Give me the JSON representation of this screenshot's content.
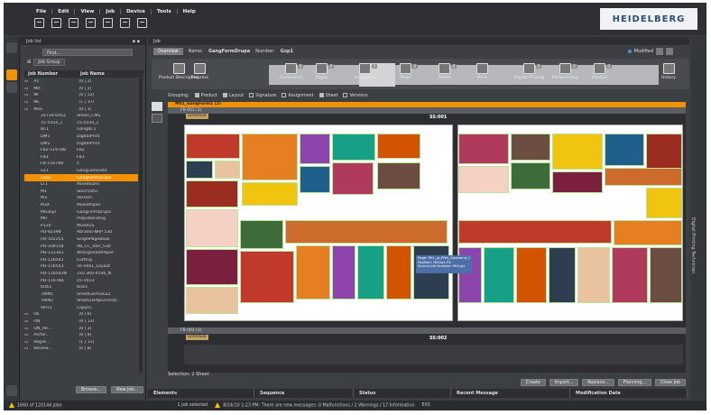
{
  "menu": [
    "File",
    "Edit",
    "View",
    "Job",
    "Device",
    "Tools",
    "Help"
  ],
  "logo": "HEIDELBERG",
  "jobs_panel": {
    "title": "Job list",
    "filter_placeholder": "Find...",
    "group_label": "Job Group",
    "col_job_number": "Job Number",
    "col_job_name": "Job Name",
    "browse_label": "Browse...",
    "new_job_label": "New Job..."
  },
  "jobs": [
    {
      "num": "A1",
      "name": "(0 | 2)",
      "folder": true
    },
    {
      "num": "MH",
      "name": "(0 | 1)",
      "folder": true
    },
    {
      "num": "MI",
      "name": "(0 | 12)",
      "folder": true
    },
    {
      "num": "ML",
      "name": "(1 | 37)",
      "folder": true
    },
    {
      "num": "MoS",
      "name": "(0 | 3)",
      "folder": true
    },
    {
      "num": "24716-0412",
      "name": "Shoes_CMS"
    },
    {
      "num": "15-5554_1",
      "name": "15-5554_1"
    },
    {
      "num": "BC1",
      "name": "GangBC1"
    },
    {
      "num": "DM1",
      "name": "DigitalPrint"
    },
    {
      "num": "DM2",
      "name": "DigitalPrint"
    },
    {
      "num": "FB2-116788",
      "name": "FB2"
    },
    {
      "num": "FB3",
      "name": "FB3"
    },
    {
      "num": "FB-116788",
      "name": "x"
    },
    {
      "num": "GL1",
      "name": "GangLaminate"
    },
    {
      "num": "Gsp1",
      "name": "GangFormDrupa",
      "selected": true
    },
    {
      "num": "LT1",
      "name": "MixedSizes"
    },
    {
      "num": "M1",
      "name": "Stochastic"
    },
    {
      "num": "M3",
      "name": "Version"
    },
    {
      "num": "M3X",
      "name": "MixedPaper"
    },
    {
      "num": "M63npl",
      "name": "GangFormDrupa"
    },
    {
      "num": "MH",
      "name": "Prep2Banding"
    },
    {
      "num": "P120",
      "name": "Mixed1S"
    },
    {
      "num": "PD-82398",
      "name": "Abradio-NRP 530"
    },
    {
      "num": "PD-102255",
      "name": "SinglePageBook"
    },
    {
      "num": "PD-108158",
      "name": "AB_CC_40H_530"
    },
    {
      "num": "PD-112301",
      "name": "WrongSheetPaper"
    },
    {
      "num": "PD-116542",
      "name": "Cutting"
    },
    {
      "num": "PD-116543",
      "name": "16-5661_Layout"
    },
    {
      "num": "PD-116543N",
      "name": "310 360-4546_N"
    },
    {
      "num": "PD-116788",
      "name": "15-1913"
    },
    {
      "num": "test3",
      "name": "test3"
    },
    {
      "num": "TWM1",
      "name": "SheetGerman22"
    },
    {
      "num": "TWM2",
      "name": "Sheet2xPtpGerman"
    },
    {
      "num": "Vers1",
      "name": "CopyFL"
    },
    {
      "num": "OE",
      "name": "(0 | 6)",
      "folder": true
    },
    {
      "num": "ON",
      "name": "(0 | 13)",
      "folder": true
    },
    {
      "num": "ON_He...",
      "name": "(0 | 3)",
      "folder": true
    },
    {
      "num": "Perfor...",
      "name": "(0 | 8)",
      "folder": true
    },
    {
      "num": "RegTe...",
      "name": "(1 | 11)",
      "folder": true
    },
    {
      "num": "Review...",
      "name": "(0 | 8)",
      "folder": true
    }
  ],
  "main": {
    "title": "Job",
    "overview_tab": "Overview",
    "name_label": "Name:",
    "name_value": "GangFormDrupa",
    "number_label": "Number:",
    "number_value": "Gsp1",
    "modified": "Modified",
    "steps": [
      {
        "label": "Product Description",
        "count": ""
      },
      {
        "label": "Prepress",
        "count": ""
      },
      {
        "label": "Documents",
        "count": "0"
      },
      {
        "label": "Pages",
        "count": "0"
      },
      {
        "label": "Imposition",
        "count": "0"
      },
      {
        "label": "Proof",
        "count": "0"
      },
      {
        "label": "Plates",
        "count": "0"
      },
      {
        "label": "Print",
        "count": ""
      },
      {
        "label": "Digital Printing",
        "count": "0"
      },
      {
        "label": "Postpressing",
        "count": "0"
      },
      {
        "label": "Product",
        "count": "0"
      },
      {
        "label": "History",
        "count": ""
      }
    ],
    "grouping_label": "Grouping:",
    "options": [
      {
        "label": "Product",
        "on": true
      },
      {
        "label": "Layout",
        "on": true
      },
      {
        "label": "Signature",
        "on": false
      },
      {
        "label": "Assignment",
        "on": false
      },
      {
        "label": "Sheet",
        "on": true
      },
      {
        "label": "Versions",
        "on": false
      }
    ],
    "layout_row": "M01_GangForm1 (2)",
    "fb1": "FB 001 (1)",
    "fb2": "FB 002 (1)",
    "schedule": "Schedule",
    "sheet1": "SS:001",
    "sheet2": "SS:002",
    "tooltip": [
      "Page: P01_Jo_Pfeil_Gaxbland_GL_47.pdf - 1",
      "Position: MGng1-P4",
      "Source Job Number: MGng1"
    ],
    "selection": "Selection: 2 Sheet",
    "buttons": [
      "Create",
      "Import...",
      "Replace...",
      "Planning...",
      "Close Job"
    ],
    "side_label": "Digital Printing Technician"
  },
  "grid_cols": [
    "Elements",
    "Sequence",
    "Status",
    "Recent Message",
    "Modification Date"
  ],
  "status": {
    "jobs": "1660 of 120144 jobs",
    "selected": "1 job selected",
    "message": "8/24/10 1:23 PM: There are new messages: 0 Malfunctions / 2 Warnings / 17 Information",
    "extra": "EXS"
  },
  "colors": {
    "accent": "#f39200",
    "bg": "#3a3d40",
    "logo_text": "#2d4d7a"
  }
}
